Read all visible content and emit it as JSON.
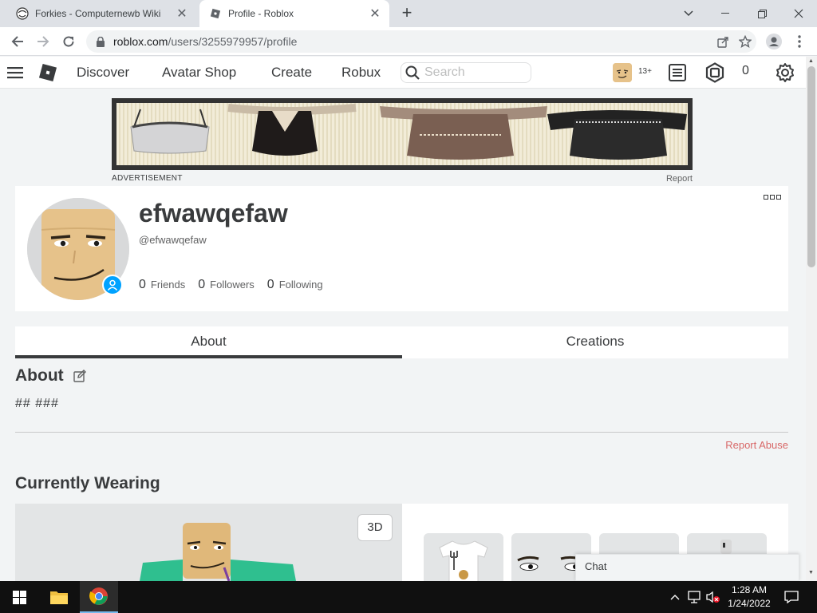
{
  "browser": {
    "tabs": [
      {
        "title": "Forkies - Computernewb Wiki",
        "active": false
      },
      {
        "title": "Profile - Roblox",
        "active": true
      }
    ],
    "url_host": "roblox.com",
    "url_path": "/users/3255979957/profile"
  },
  "header": {
    "nav": [
      "Discover",
      "Avatar Shop",
      "Create",
      "Robux"
    ],
    "search_placeholder": "Search",
    "age_badge": "13+",
    "robux_count": "0"
  },
  "ad": {
    "label": "ADVERTISEMENT",
    "report": "Report"
  },
  "profile": {
    "display_name": "efwawqefaw",
    "username": "@efwawqefaw",
    "friends_count": "0",
    "friends_label": "Friends",
    "followers_count": "0",
    "followers_label": "Followers",
    "following_count": "0",
    "following_label": "Following"
  },
  "profile_tabs": [
    {
      "label": "About",
      "active": true
    },
    {
      "label": "Creations",
      "active": false
    }
  ],
  "about": {
    "title": "About",
    "text": "## ###",
    "report_abuse": "Report Abuse"
  },
  "wearing": {
    "title": "Currently Wearing",
    "btn_3d": "3D"
  },
  "chat": {
    "label": "Chat"
  },
  "taskbar": {
    "time": "1:28 AM",
    "date": "1/24/2022"
  },
  "colors": {
    "accent_blue": "#00a2ff",
    "report_red": "#d86868",
    "page_bg": "#f2f4f5"
  }
}
